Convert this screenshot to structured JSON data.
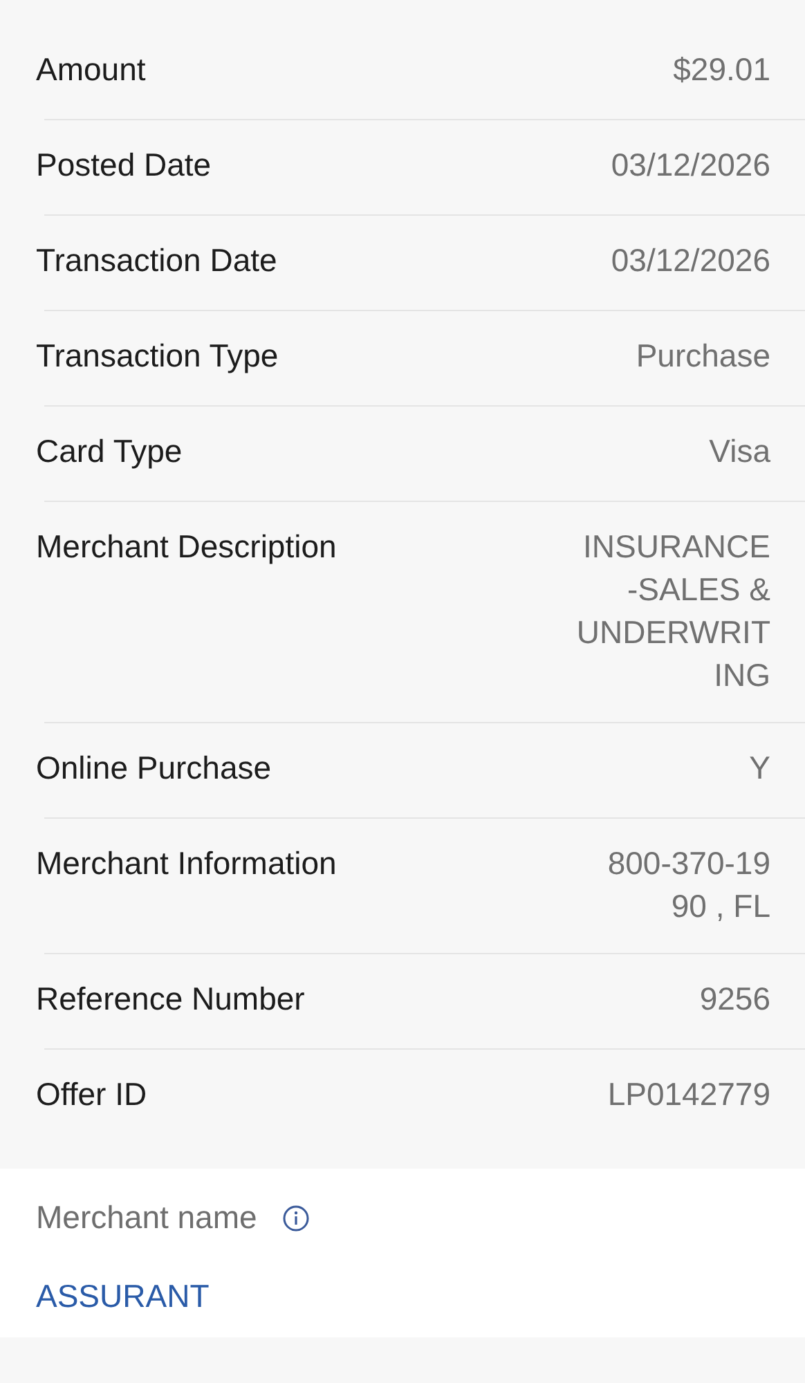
{
  "details": [
    {
      "label": "Amount",
      "value_lines": [
        "$29.01"
      ]
    },
    {
      "label": "Posted Date",
      "value_lines": [
        "03/12/2026"
      ]
    },
    {
      "label": "Transaction Date",
      "value_lines": [
        "03/12/2026"
      ]
    },
    {
      "label": "Transaction Type",
      "value_lines": [
        "Purchase"
      ]
    },
    {
      "label": "Card Type",
      "value_lines": [
        "Visa"
      ]
    },
    {
      "label": "Merchant Description",
      "value_lines": [
        "INSURANCE",
        "-SALES &",
        "UNDERWRIT",
        "ING"
      ]
    },
    {
      "label": "Online Purchase",
      "value_lines": [
        "Y"
      ]
    },
    {
      "label": "Merchant Information",
      "value_lines": [
        "800-370-19",
        "90 , FL"
      ]
    },
    {
      "label": "Reference Number",
      "value_lines": [
        "9256"
      ]
    },
    {
      "label": "Offer ID",
      "value_lines": [
        "LP0142779"
      ]
    }
  ],
  "merchant": {
    "label": "Merchant name",
    "name": "ASSURANT"
  }
}
